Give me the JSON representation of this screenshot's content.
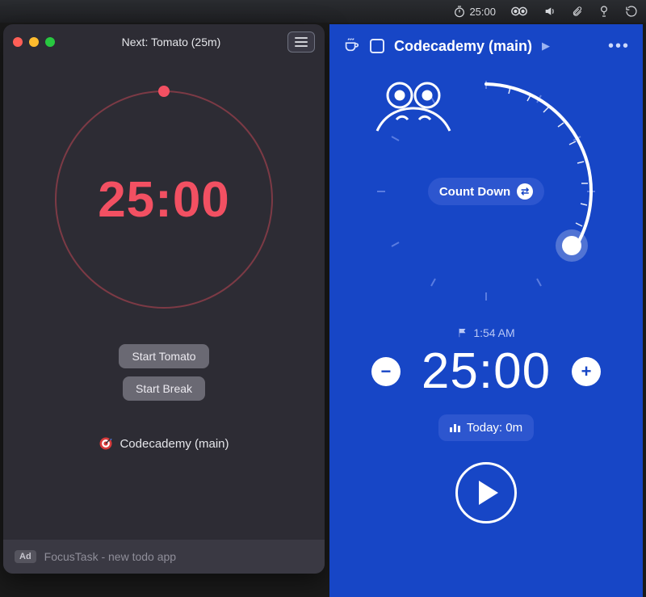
{
  "menubar": {
    "timer_text": "25:00"
  },
  "left": {
    "title": "Next: Tomato (25m)",
    "time": "25:00",
    "start_tomato": "Start Tomato",
    "start_break": "Start Break",
    "task": "Codecademy (main)",
    "ad_tag": "Ad",
    "ad_text": "FocusTask - new todo app"
  },
  "right": {
    "title": "Codecademy (main)",
    "countdown_label": "Count Down",
    "alarm_time": "1:54 AM",
    "time": "25:00",
    "today_label": "Today: 0m"
  }
}
